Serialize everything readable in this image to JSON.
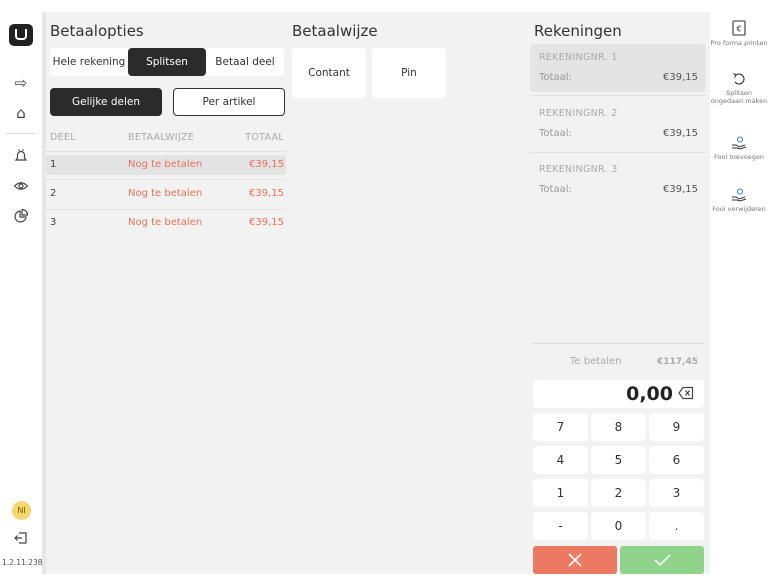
{
  "rail": {
    "avatar_initials": "NI",
    "version": "1.2.11.238"
  },
  "betaalopties": {
    "title": "Betaalopties",
    "tabs": [
      "Hele rekening",
      "Splitsen",
      "Betaal deel"
    ],
    "split_modes": [
      "Gelijke delen",
      "Per artikel"
    ],
    "columns": [
      "DEEL",
      "BETAALWIJZE",
      "TOTAAL"
    ],
    "rows": [
      {
        "deel": "1",
        "wijze": "Nog te betalen",
        "totaal": "€39,15"
      },
      {
        "deel": "2",
        "wijze": "Nog te betalen",
        "totaal": "€39,15"
      },
      {
        "deel": "3",
        "wijze": "Nog te betalen",
        "totaal": "€39,15"
      }
    ]
  },
  "betaalwijze": {
    "title": "Betaalwijze",
    "methods": [
      "Contant",
      "Pin"
    ]
  },
  "rekeningen": {
    "title": "Rekeningen",
    "accounts": [
      {
        "nr": "REKENINGNR. 1",
        "label": "Totaal:",
        "amount": "€39,15"
      },
      {
        "nr": "REKENINGNR. 2",
        "label": "Totaal:",
        "amount": "€39,15"
      },
      {
        "nr": "REKENINGNR. 3",
        "label": "Totaal:",
        "amount": "€39,15"
      }
    ],
    "te_betalen_label": "Te betalen",
    "te_betalen_amount": "€117,45",
    "display_value": "0,00",
    "keys": [
      "7",
      "8",
      "9",
      "4",
      "5",
      "6",
      "1",
      "2",
      "3",
      "-",
      "0",
      "."
    ]
  },
  "right_actions": [
    {
      "label": "Pro forma printen"
    },
    {
      "label": "Splitsen ongedaan maken"
    },
    {
      "label": "Fooi toevoegen"
    },
    {
      "label": "Fooi verwijderen"
    }
  ],
  "colors": {
    "accent_dark": "#2b2b2b",
    "pending": "#e8735a",
    "cancel": "#ec7a62",
    "confirm": "#8fd48a"
  }
}
